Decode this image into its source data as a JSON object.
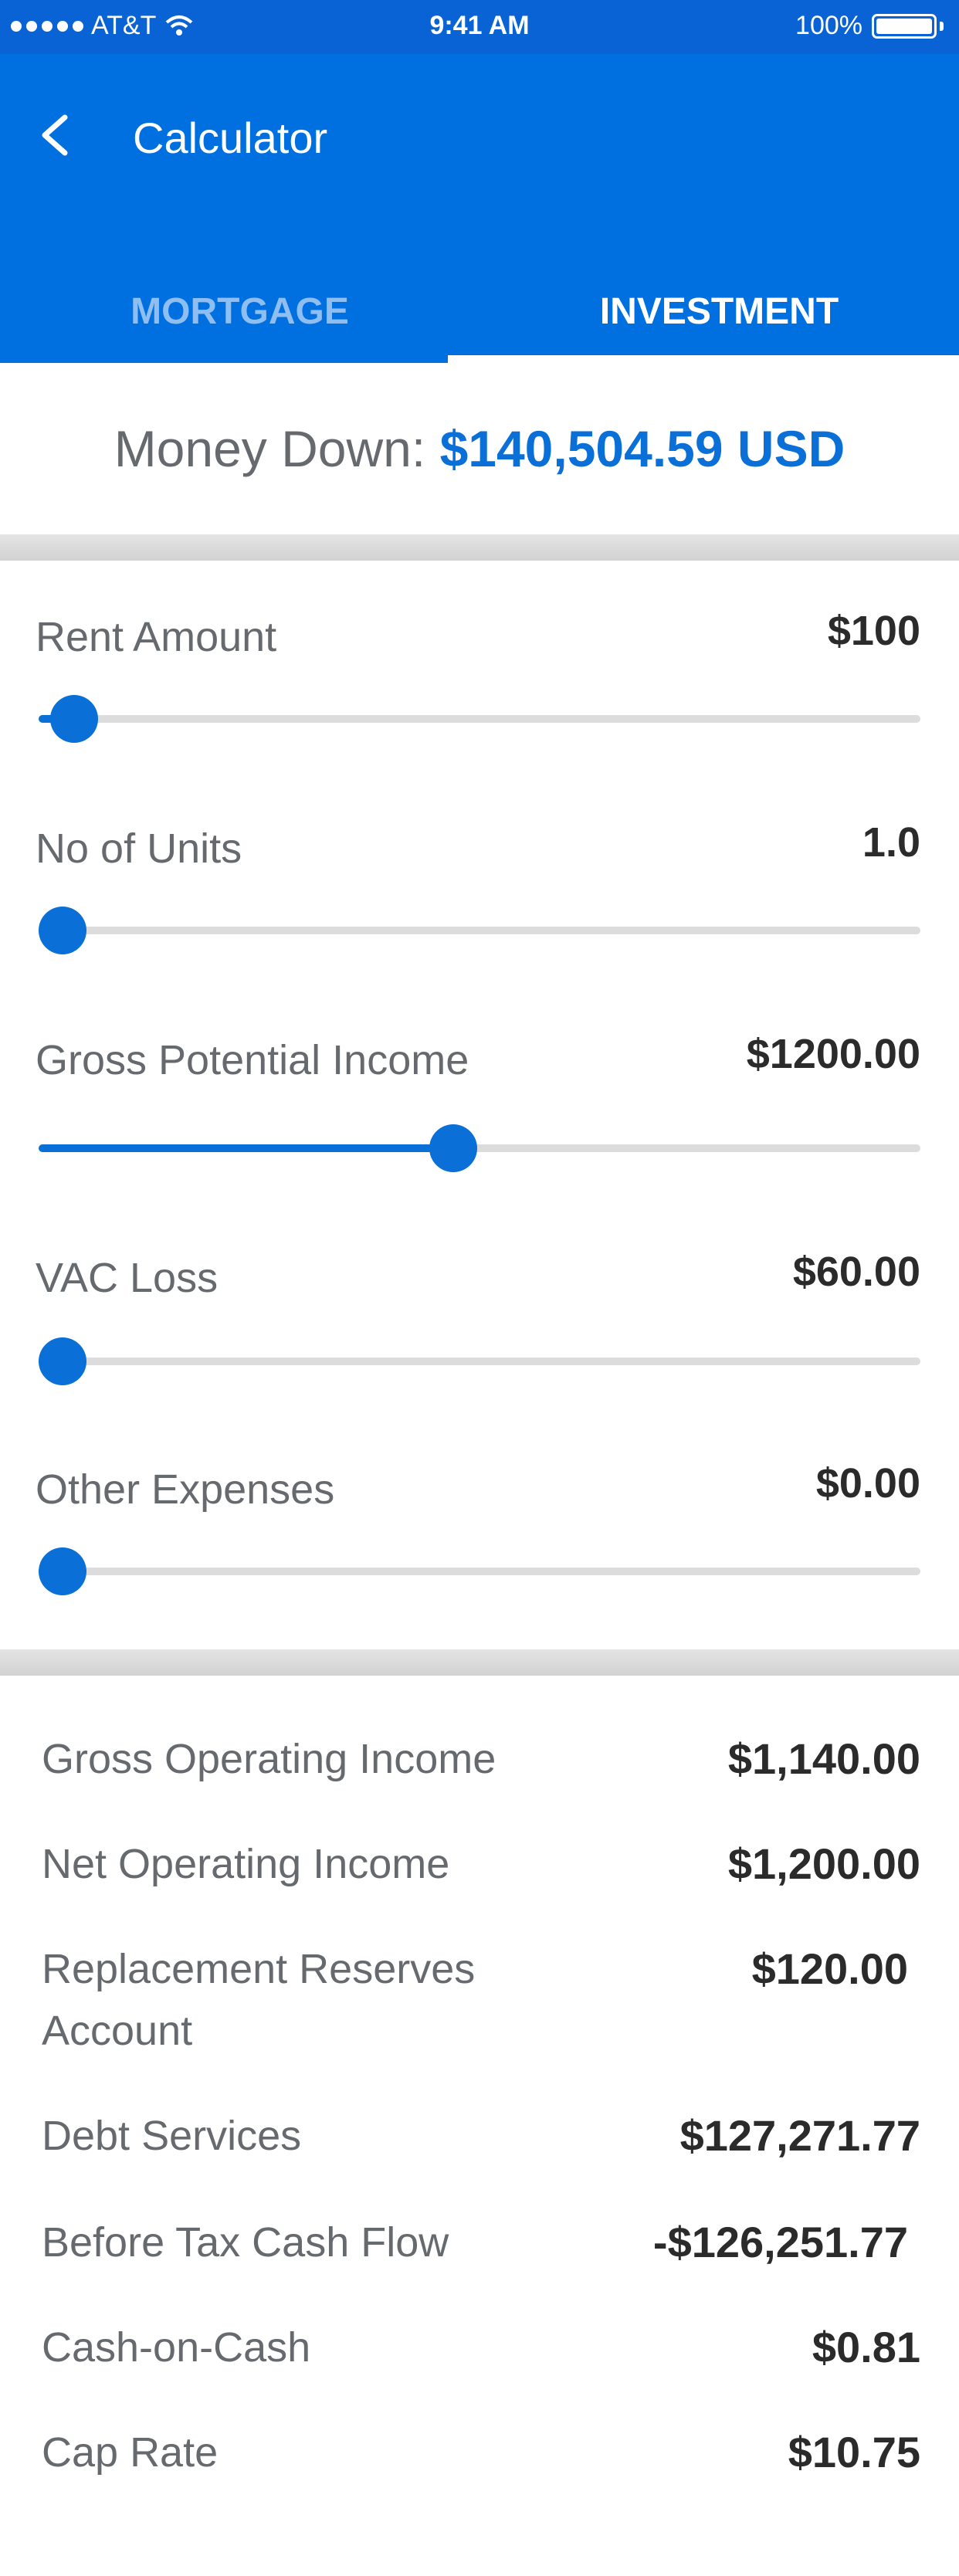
{
  "status_bar": {
    "carrier": "AT&T",
    "time": "9:41 AM",
    "battery": "100%"
  },
  "header": {
    "title": "Calculator",
    "back_icon": "chevron-left-icon",
    "tabs": [
      {
        "label": "MORTGAGE",
        "active": false
      },
      {
        "label": "INVESTMENT",
        "active": true
      }
    ]
  },
  "money_down": {
    "label": "Money Down:",
    "amount": "$140,504.59 USD"
  },
  "sliders": [
    {
      "label": "Rent Amount",
      "value": "$100",
      "level": 0.04
    },
    {
      "label": "No of Units",
      "value": "1.0",
      "level": 0.0
    },
    {
      "label": "Gross Potential Income",
      "value": "$1200.00",
      "level": 0.47
    },
    {
      "label": "VAC Loss",
      "value": "$60.00",
      "level": 0.025
    },
    {
      "label": "Other Expenses",
      "value": "$0.00",
      "level": 0.0
    }
  ],
  "results": [
    {
      "label": "Gross Operating Income",
      "value": "$1,140.00"
    },
    {
      "label": "Net Operating Income",
      "value": "$1,200.00"
    },
    {
      "label": "Replacement Reserves Account",
      "value": "$120.00"
    },
    {
      "label": "Debt Services",
      "value": "$127,271.77"
    },
    {
      "label": "Before Tax Cash Flow",
      "value": "-$126,251.77"
    },
    {
      "label": "Cash-on-Cash",
      "value": "$0.81"
    },
    {
      "label": "Cap Rate",
      "value": "$10.75"
    }
  ],
  "colors": {
    "primary": "#0070e0",
    "accent": "#0a6fd6",
    "text_muted": "#666a6e",
    "text_dark": "#2b2b2b"
  }
}
